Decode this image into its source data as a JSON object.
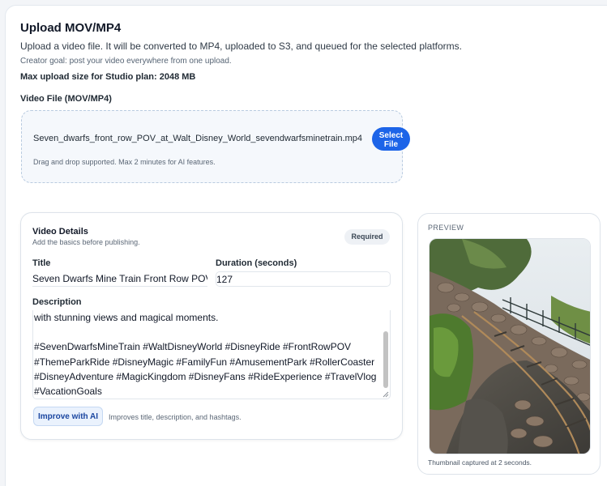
{
  "header": {
    "title": "Upload MOV/MP4",
    "subtitle": "Upload a video file. It will be converted to MP4, uploaded to S3, and queued for the selected platforms.",
    "goal": "Creator goal: post your video everywhere from one upload.",
    "max_upload": "Max upload size for Studio plan: 2048 MB"
  },
  "upload": {
    "label": "Video File (MOV/MP4)",
    "filename": "Seven_dwarfs_front_row_POV_at_Walt_Disney_World_sevendwarfsminetrain.mp4",
    "select_button": "Select\nFile",
    "hint": "Drag and drop supported. Max 2 minutes for AI features."
  },
  "details": {
    "title": "Video Details",
    "subtitle": "Add the basics before publishing.",
    "badge": "Required",
    "title_label": "Title",
    "title_value": "Seven Dwarfs Mine Train Front Row POV",
    "duration_label": "Duration (seconds)",
    "duration_value": "127",
    "description_label": "Description",
    "description_value": "with stunning views and magical moments.\n\n#SevenDwarfsMineTrain #WaltDisneyWorld #DisneyRide #FrontRowPOV #ThemeParkRide #DisneyMagic #FamilyFun #AmusementPark #RollerCoaster #DisneyAdventure #MagicKingdom #DisneyFans #RideExperience #TravelVlog #VacationGoals",
    "improve_button": "Improve with AI",
    "improve_hint": "Improves title, description, and hashtags."
  },
  "preview": {
    "label": "PREVIEW",
    "caption": "Thumbnail captured at 2 seconds."
  },
  "colors": {
    "accent": "#1d64e8",
    "ai_button_bg": "#eaf2fd",
    "ai_button_text": "#1a46a0"
  }
}
